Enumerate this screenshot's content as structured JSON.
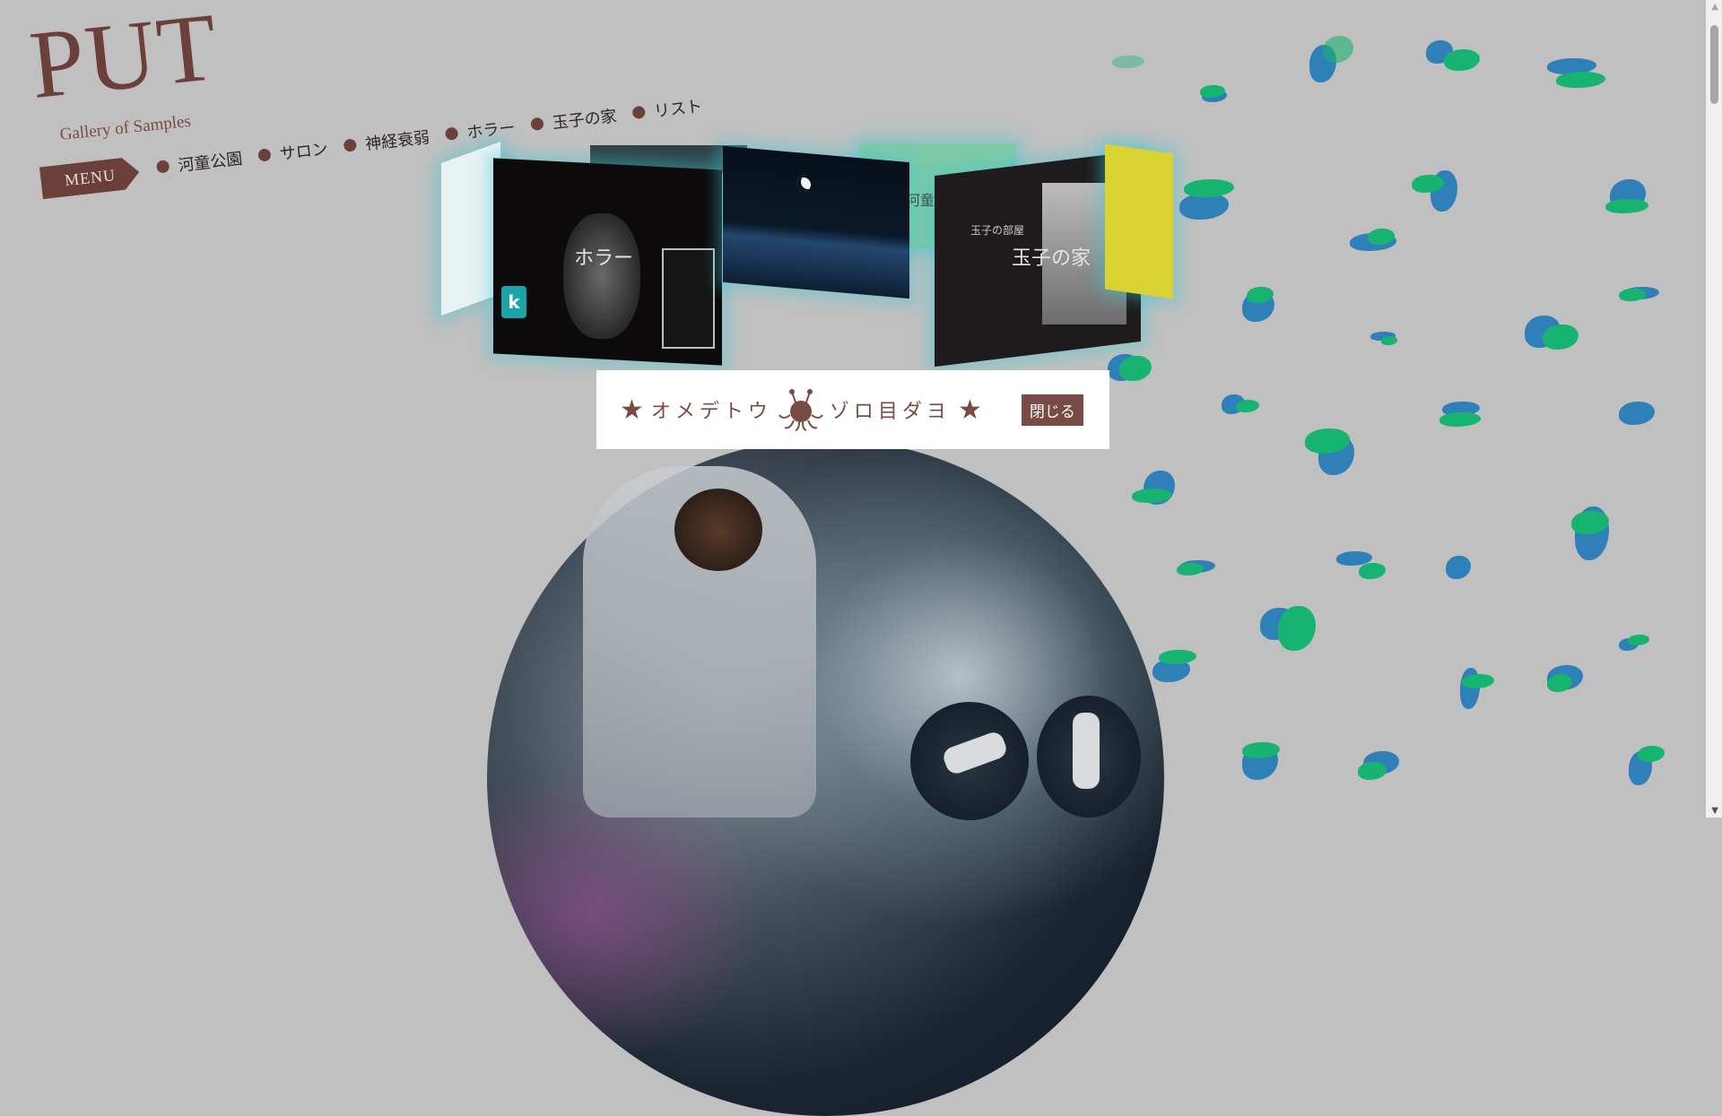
{
  "logo": {
    "title": "PUT",
    "subtitle": "Gallery of  Samples"
  },
  "menu_label": "MENU",
  "nav": [
    {
      "label": "河童公園"
    },
    {
      "label": "サロン"
    },
    {
      "label": "神経衰弱"
    },
    {
      "label": "ホラー"
    },
    {
      "label": "玉子の家"
    },
    {
      "label": "リスト"
    }
  ],
  "carousel": {
    "horror_label": "ホラー",
    "egg_label": "玉子の家",
    "egg_small_title": "玉子の部屋",
    "green_label": "河童公"
  },
  "dialog": {
    "left_text": "オメデトウ",
    "right_text": "ゾロ目ダヨ",
    "close_label": "閉じる"
  },
  "icons": {
    "star": "star-icon",
    "monster": "flying-spaghetti-monster-icon"
  },
  "colors": {
    "background": "#c0c0c0",
    "brand": "#6b3f3a",
    "blob_blue": "#2f7fb8",
    "blob_green": "#17b371"
  }
}
